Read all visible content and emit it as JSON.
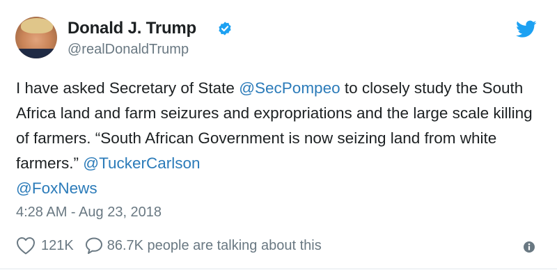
{
  "author": {
    "display_name": "Donald J. Trump",
    "handle": "@realDonaldTrump",
    "verified": true
  },
  "tweet": {
    "text_part1": "I have asked Secretary of State ",
    "mention1": "@SecPompeo",
    "text_part2": " to closely study the South Africa land and farm seizures and expropriations and the large scale killing of farmers. “South African Government is now seizing land from white farmers.” ",
    "mention2": "@TuckerCarlson",
    "mention3": "@FoxNews",
    "timestamp": "4:28 AM - Aug 23, 2018"
  },
  "actions": {
    "like_count": "121K",
    "reply_text": "86.7K people are talking about this"
  },
  "icons": {
    "verified": "verified-badge-icon",
    "twitter": "twitter-bird-icon",
    "like": "heart-icon",
    "reply": "speech-bubble-icon",
    "info": "info-icon"
  },
  "colors": {
    "text": "#1c2022",
    "secondary": "#697882",
    "link": "#2b7bb9",
    "twitter_blue": "#1da1f2",
    "divider": "#e1e8ed"
  }
}
